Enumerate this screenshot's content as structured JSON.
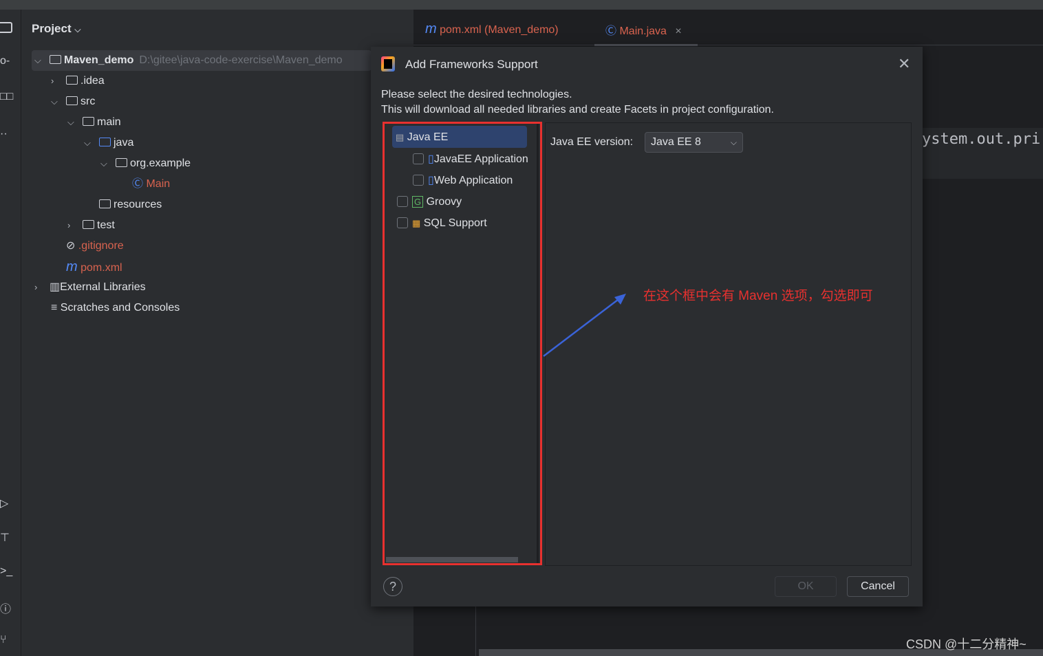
{
  "project_panel": {
    "title": "Project",
    "root": {
      "name": "Maven_demo",
      "path": "D:\\gitee\\java-code-exercise\\Maven_demo"
    },
    "items": [
      ".idea",
      "src",
      "main",
      "java",
      "org.example",
      "Main",
      "resources",
      "test",
      ".gitignore",
      "pom.xml",
      "External Libraries",
      "Scratches and Consoles"
    ]
  },
  "tabs": [
    {
      "label": "pom.xml (Maven_demo)"
    },
    {
      "label": "Main.java"
    }
  ],
  "editor": {
    "code_fragment": "ystem.out.pri"
  },
  "dialog": {
    "title": "Add Frameworks Support",
    "desc1": "Please select the desired technologies.",
    "desc2": "This will download all needed libraries and create Facets in project configuration.",
    "items": [
      "Java EE",
      "JavaEE Application",
      "Web Application",
      "Groovy",
      "SQL Support"
    ],
    "version_label": "Java EE version:",
    "version_value": "Java EE 8",
    "ok": "OK",
    "cancel": "Cancel",
    "help": "?"
  },
  "annotation": "在这个框中会有 Maven 选项，勾选即可",
  "watermark": "CSDN @十二分精神~",
  "colors": {
    "annotation": "#e8312f",
    "arrow": "#3a63d8",
    "selection": "#2e436e"
  }
}
